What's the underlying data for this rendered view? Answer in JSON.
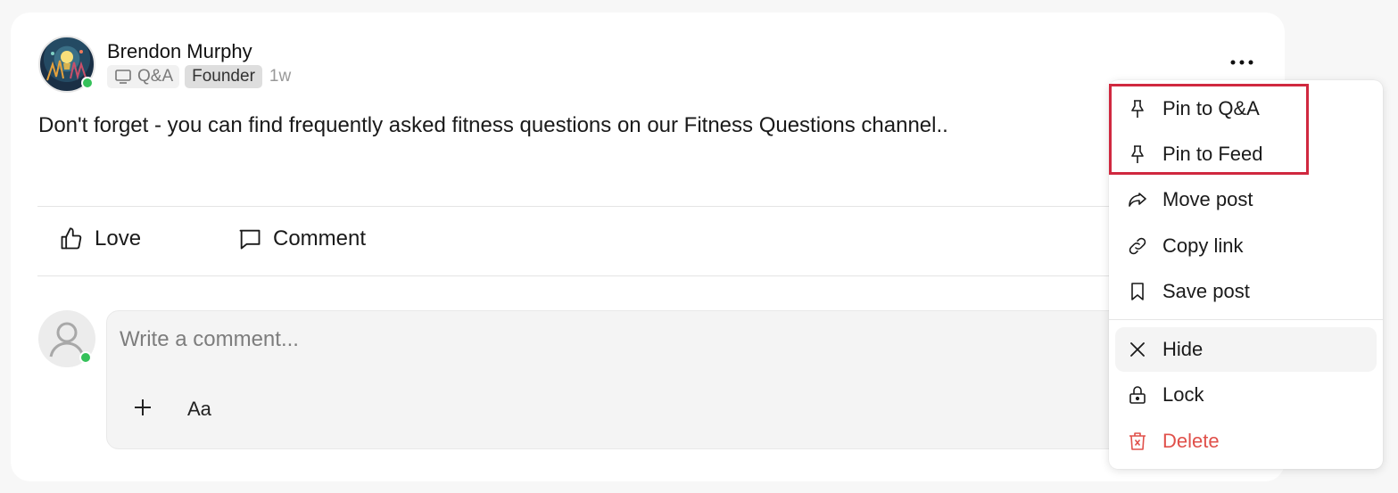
{
  "post": {
    "author_name": "Brendon Murphy",
    "channel": "Q&A",
    "role_badge": "Founder",
    "time_ago": "1w",
    "body": "Don't forget - you can find frequently asked fitness questions on our Fitness Questions channel..",
    "more_icon": "more-horizontal-icon"
  },
  "actions": {
    "love_label": "Love",
    "comment_label": "Comment"
  },
  "comment_box": {
    "placeholder": "Write a comment...",
    "add_icon": "plus-icon",
    "format_label": "Aa"
  },
  "menu": {
    "items": [
      {
        "label": "Pin to Q&A",
        "icon": "pin-icon"
      },
      {
        "label": "Pin to Feed",
        "icon": "pin-icon"
      },
      {
        "label": "Move post",
        "icon": "share-arrow-icon"
      },
      {
        "label": "Copy link",
        "icon": "link-icon"
      },
      {
        "label": "Save post",
        "icon": "bookmark-icon"
      },
      {
        "label": "Hide",
        "icon": "close-icon"
      },
      {
        "label": "Lock",
        "icon": "lock-icon"
      },
      {
        "label": "Delete",
        "icon": "trash-icon"
      }
    ]
  },
  "colors": {
    "online": "#35c15a",
    "danger": "#e0504a",
    "highlight": "#d0283f"
  }
}
